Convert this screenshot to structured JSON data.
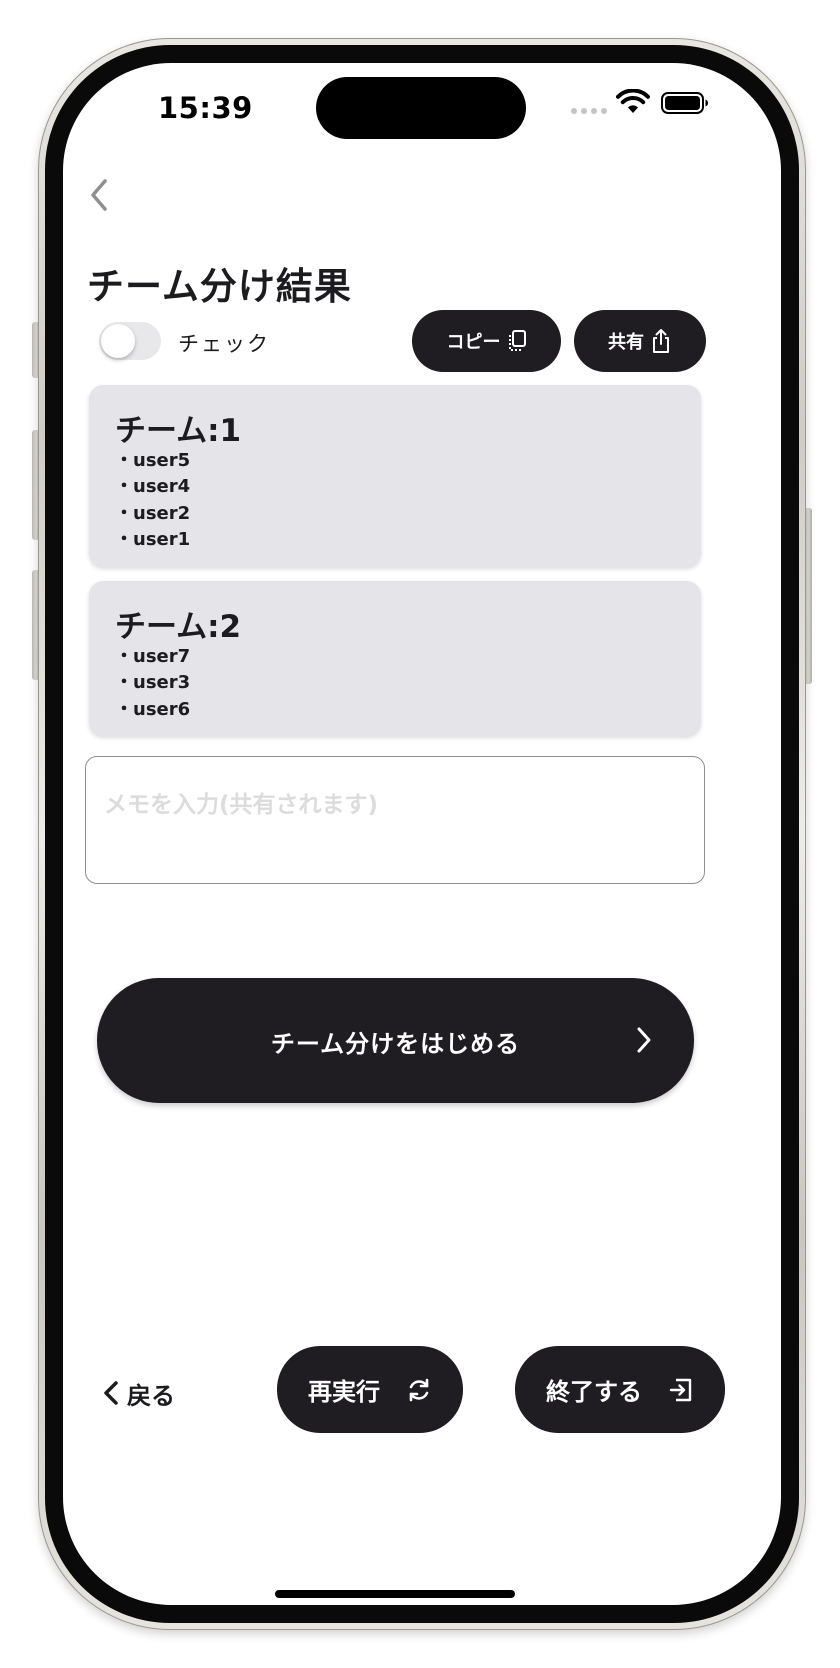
{
  "status_bar": {
    "time": "15:39"
  },
  "page": {
    "title": "チーム分け結果"
  },
  "check_toggle": {
    "label": "チェック"
  },
  "actions": {
    "copy_label": "コピー",
    "share_label": "共有"
  },
  "teams": [
    {
      "name": "チーム:1",
      "members": [
        "・user5",
        "・user4",
        "・user2",
        "・user1"
      ]
    },
    {
      "name": "チーム:2",
      "members": [
        "・user7",
        "・user3",
        "・user6"
      ]
    }
  ],
  "memo": {
    "placeholder": "メモを入力(共有されます)",
    "value": ""
  },
  "start_button": {
    "label": "チーム分けをはじめる"
  },
  "bottom_bar": {
    "back_label": "戻る",
    "rerun_label": "再実行",
    "finish_label": "終了する"
  },
  "colors": {
    "button_dark": "#1f1d21",
    "card_background": "#e5e4e9",
    "text_primary": "#1c1b1f",
    "placeholder": "#dcdcdc"
  }
}
